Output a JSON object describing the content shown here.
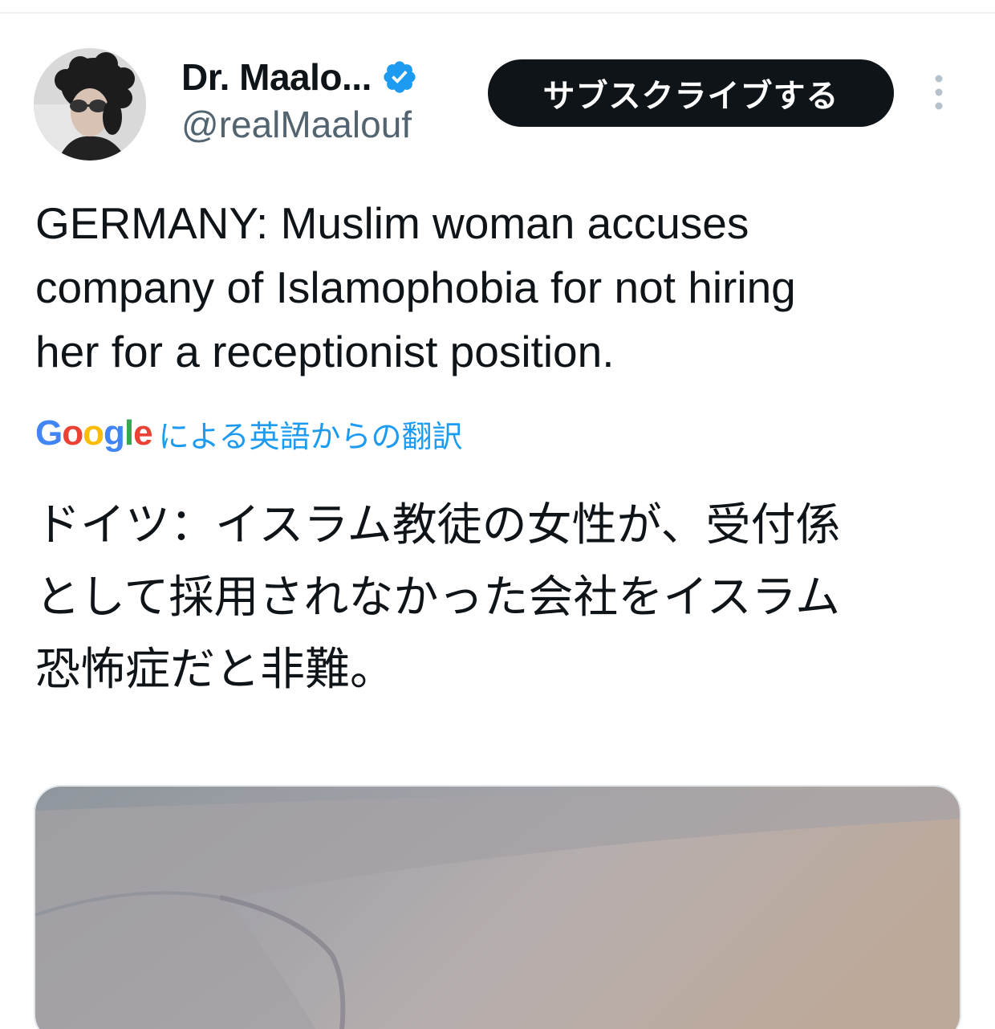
{
  "author": {
    "display_name": "Dr. Maalo...",
    "handle": "@realMaalouf",
    "verified": true,
    "avatar_icon": "user-avatar-photo"
  },
  "actions": {
    "subscribe_label": "サブスクライブする",
    "more_icon": "more-vertical-icon"
  },
  "tweet": {
    "text": "GERMANY: Muslim woman accuses\ncompany of Islamophobia for not hiring\nher for a receptionist position.",
    "translation_provider": "Google",
    "translation_label": "による英語からの翻訳",
    "translated_text": "ドイツ：イスラム教徒の女性が、受付係\nとして採用されなかった会社をイスラム\n恐怖症だと非難。"
  },
  "media": {
    "type": "image"
  },
  "colors": {
    "text_primary": "#0f1419",
    "text_secondary": "#536471",
    "accent_blue": "#1d9bf0",
    "button_dark": "#0f1419"
  }
}
